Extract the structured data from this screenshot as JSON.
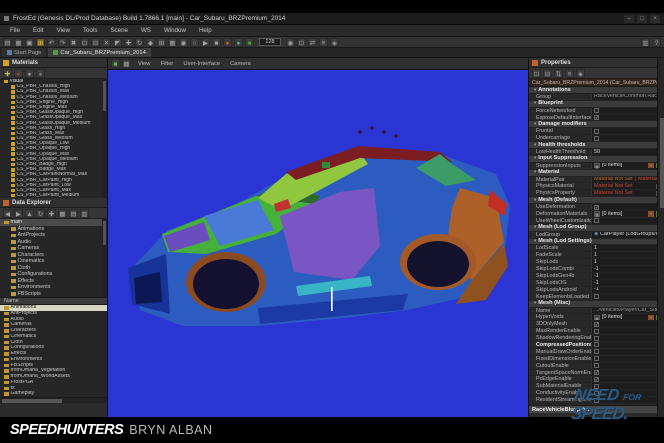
{
  "colors": {
    "viewport_bg": "#2b35d4",
    "not_set_red": "#d04038",
    "nfs_blue": "#2c5a80",
    "material_icon_yellow": "#c9a227"
  },
  "window": {
    "title": "FrostEd (Genesis DL/Prod Database) Build 1.7866.1 [main] - Car_Subaru_BRZPremium_2014",
    "controls": {
      "minimize": "–",
      "maximize": "□",
      "close": "×"
    },
    "menus": [
      "File",
      "Edit",
      "View",
      "Tools",
      "Scene",
      "WS",
      "Window",
      "Help"
    ]
  },
  "toolbar": {
    "zoom_value": "128",
    "icons_a": [
      {
        "n": "new-file-icon",
        "g": "▤"
      },
      {
        "n": "open-icon",
        "g": "▦"
      },
      {
        "n": "save-icon",
        "g": "▣"
      },
      {
        "n": "save-all-icon",
        "g": "⊞",
        "bg": "#6a5a22",
        "c": "#e8c84a"
      },
      {
        "n": "undo-icon",
        "g": "↶"
      },
      {
        "n": "redo-icon",
        "g": "↷"
      },
      {
        "n": "cut-icon",
        "g": "✖"
      },
      {
        "n": "copy-icon",
        "g": "⊡"
      },
      {
        "n": "paste-icon",
        "g": "⊟"
      },
      {
        "n": "delete-icon",
        "g": "✕"
      },
      {
        "n": "select-icon",
        "g": "◤"
      },
      {
        "n": "translate-icon",
        "g": "✚"
      },
      {
        "n": "rotate-icon",
        "g": "↻"
      },
      {
        "n": "scale-icon",
        "g": "◆"
      },
      {
        "n": "snap-icon",
        "g": "⊞"
      },
      {
        "n": "grid-icon",
        "g": "▦"
      },
      {
        "n": "local-space-icon",
        "g": "◉"
      },
      {
        "n": "world-space-icon",
        "g": "○"
      },
      {
        "n": "play-icon",
        "g": "▶"
      },
      {
        "n": "stop-icon",
        "g": "■"
      },
      {
        "n": "physics-icon",
        "g": "●",
        "c": "#c0622e"
      },
      {
        "n": "lighting-icon",
        "g": "●",
        "c": "#4da6a0"
      },
      {
        "n": "render-mode-icon",
        "g": "■",
        "c": "#4e8f46"
      }
    ],
    "icons_b": [
      {
        "n": "camera-icon",
        "g": "◉"
      },
      {
        "n": "frame-selected-icon",
        "g": "⊡"
      },
      {
        "n": "measure-icon",
        "g": "⇄"
      },
      {
        "n": "layers-icon",
        "g": "≡"
      },
      {
        "n": "settings-icon",
        "g": "◈"
      }
    ],
    "icons_right": [
      {
        "n": "layout-icon",
        "g": "▥"
      },
      {
        "n": "help-icon",
        "g": "?"
      }
    ]
  },
  "tabs": {
    "start_page": "Start Page",
    "active_tab": "Car_Subaru_BRZPremium_2014"
  },
  "materials_panel": {
    "title": "Materials",
    "tools": [
      {
        "n": "add-material-icon",
        "g": "✚",
        "c": "#d8b93a"
      },
      {
        "n": "sphere-preview-icon",
        "g": "●",
        "c": "#8a4a3a"
      },
      {
        "n": "sphere-preview-icon",
        "g": "●",
        "c": "#999999"
      },
      {
        "n": "sphere-preview-icon",
        "g": "●",
        "c": "#777777"
      }
    ],
    "root": "Visual",
    "items": [
      "CS_PBR_Chassis_High",
      "CS_PBR_Chassis_Max",
      "CS_PBR_Chassis_Medium",
      "CS_PBR_Engine_High",
      "CS_PBR_Engine_Max",
      "CS_PBR_GlassOpaque_High",
      "CS_PBR_GlassOpaque_Max",
      "CS_PBR_GlassOpaque_Medium",
      "CS_PBR_Glass_High",
      "CS_PBR_Glass_Max",
      "CS_PBR_Glass_Medium",
      "CS_PBR_Opaque_Low",
      "CS_PBR_Opaque_High",
      "CS_PBR_Opaque_Max",
      "CS_PBR_Opaque_Medium",
      "CS_PBR_Badge_High",
      "CS_PBR_Badge_Max",
      "CS_PBR_CarPaintNormal_Max",
      "CS_PBR_CarPaint_High",
      "CS_PBR_CarPaint_Low",
      "CS_PBR_CarPaint_Max",
      "CS_PBR_CarPaint_Medium"
    ]
  },
  "data_explorer": {
    "title": "Data Explorer",
    "tools": [
      {
        "n": "back-icon",
        "g": "◀"
      },
      {
        "n": "forward-icon",
        "g": "▶"
      },
      {
        "n": "up-icon",
        "g": "▲"
      },
      {
        "n": "refresh-icon",
        "g": "↻"
      },
      {
        "n": "add-icon",
        "g": "✚"
      },
      {
        "n": "view-grid-icon",
        "g": "▦"
      },
      {
        "n": "view-list-icon",
        "g": "▤"
      },
      {
        "n": "view-details-icon",
        "g": "▥"
      }
    ],
    "tree_root": "main",
    "tree": [
      "Animations",
      "AntProjects",
      "Audio",
      "Cameras",
      "Characters",
      "Cinematics",
      "Cloth",
      "Configurations",
      "Effects",
      "Environments",
      "FBScripts"
    ],
    "name_header": "Name",
    "selected_folder": "Animations",
    "folders": [
      "Animations",
      "AntProjects",
      "Audio",
      "Cameras",
      "Characters",
      "Cinematics",
      "Cloth",
      "Configurations",
      "Effects",
      "Environments",
      "FBScripts",
      "fromOmaha_Vegetation",
      "fromOmaha_WorldAssets",
      "FrostPGA",
      "fx",
      "Gameplay"
    ]
  },
  "viewport": {
    "menus": [
      "View",
      "Filter",
      "User-Interface",
      "Camera"
    ]
  },
  "properties": {
    "title": "Properties",
    "tools": [
      {
        "n": "copy-props-icon",
        "g": "⊡"
      },
      {
        "n": "paste-props-icon",
        "g": "⊟"
      },
      {
        "n": "expand-all-icon",
        "g": "⇅"
      },
      {
        "n": "collapse-all-icon",
        "g": "≡"
      },
      {
        "n": "pin-icon",
        "g": "◈"
      }
    ],
    "object_bar": "Car_Subaru_BRZPremium_2014 (Car_Subaru_BRZPremium_2014)",
    "sections": [
      {
        "label": "Annotations",
        "rows": [
          {
            "t": "path",
            "l": "Group",
            "v": "RaceVehicleCommon.RaceVehicleEntity"
          }
        ]
      },
      {
        "label": "Blueprint",
        "rows": [
          {
            "t": "check",
            "l": "ForceNetworked",
            "c": false
          },
          {
            "t": "check",
            "l": "ExposeDefaultInterface",
            "c": true
          }
        ]
      },
      {
        "label": "Damage modifiers",
        "rows": [
          {
            "t": "check",
            "l": "Frontal",
            "c": false
          },
          {
            "t": "check",
            "l": "Undercarriage",
            "c": false
          }
        ]
      },
      {
        "label": "Health thresholds",
        "rows": [
          {
            "t": "text",
            "l": "LowHealthThreshold",
            "v": "50"
          }
        ]
      },
      {
        "label": "Input Suppression",
        "rows": [
          {
            "t": "items",
            "l": "SuppressionInputs",
            "v": "[0 items]"
          }
        ]
      },
      {
        "label": "Material",
        "rows": [
          {
            "t": "matpair",
            "l": "MaterialPair",
            "v1": "Material Not Set",
            "v2": "Material Not Set"
          },
          {
            "t": "material",
            "l": "PhysicsMaterial",
            "v": "Material Not Set"
          },
          {
            "t": "material",
            "l": "PhysicsProperty",
            "v": "Material Not Set"
          }
        ]
      },
      {
        "label": "Mesh (Default)",
        "rows": [
          {
            "t": "check",
            "l": "UseDeformation",
            "c": true
          },
          {
            "t": "items",
            "l": "DeformationMaterials",
            "v": "[0 items]"
          },
          {
            "t": "check",
            "l": "UseWheelCustomization",
            "c": false
          }
        ]
      },
      {
        "label": "Mesh (Lod Group)",
        "rows": [
          {
            "t": "dropdown",
            "l": "LodGroup",
            "v": "CarPlayer (LodGroups/CarPl..."
          }
        ]
      },
      {
        "label": "Mesh (Lod Settings)",
        "rows": [
          {
            "t": "text",
            "l": "LodScale",
            "v": "1"
          },
          {
            "t": "text",
            "l": "FadeScale",
            "v": "1"
          },
          {
            "t": "text",
            "l": "SkipLods",
            "v": "1"
          },
          {
            "t": "text",
            "l": "SkipLodsCombi",
            "v": "-1"
          },
          {
            "t": "text",
            "l": "SkipLodsGen4b",
            "v": "-1"
          },
          {
            "t": "text",
            "l": "SkipLodsOG",
            "v": "-1"
          },
          {
            "t": "text",
            "l": "SkipLodsAndroid",
            "v": "-1"
          },
          {
            "t": "check",
            "l": "KeepElementsLoaded",
            "c": false
          }
        ]
      },
      {
        "label": "Mesh (Misc)",
        "rows": [
          {
            "t": "path",
            "l": "Name",
            "v": ".../vehicles/Player/Car_Subaru_BRZPremiu"
          },
          {
            "t": "items",
            "l": "HyperVoids",
            "v": "[0 items]"
          },
          {
            "t": "check",
            "l": "3DOnlyMesh",
            "c": true
          },
          {
            "t": "check",
            "l": "MaxRenderEnable",
            "c": false
          },
          {
            "t": "check",
            "l": "ShadowRenderingEnable",
            "c": false
          },
          {
            "t": "check",
            "l": "CompressedPositionsEnable",
            "c": false,
            "b": true
          },
          {
            "t": "check",
            "l": "ManualDrawOrderEnable",
            "c": false
          },
          {
            "t": "check",
            "l": "FixedDimensionEnable",
            "c": false
          },
          {
            "t": "check",
            "l": "CutoutEnable",
            "c": false
          },
          {
            "t": "check",
            "l": "TangentSpaceNormEnable",
            "c": true
          },
          {
            "t": "check",
            "l": "PcEdgeEnable",
            "c": true
          },
          {
            "t": "check",
            "l": "SubMaterialEnable",
            "c": false
          },
          {
            "t": "check",
            "l": "ConductivityEnable",
            "c": false
          },
          {
            "t": "check",
            "l": "ResidentStreamingEnable",
            "c": false
          }
        ]
      }
    ],
    "status": "RaceVehicleBlueprint",
    "help": "?"
  },
  "branding": {
    "speedhunters": "SPEEDHUNTERS",
    "author": "BRYN ALBAN",
    "nfs_line1": "NEED",
    "nfs_for": "FOR",
    "nfs_line2": "SPEED."
  }
}
